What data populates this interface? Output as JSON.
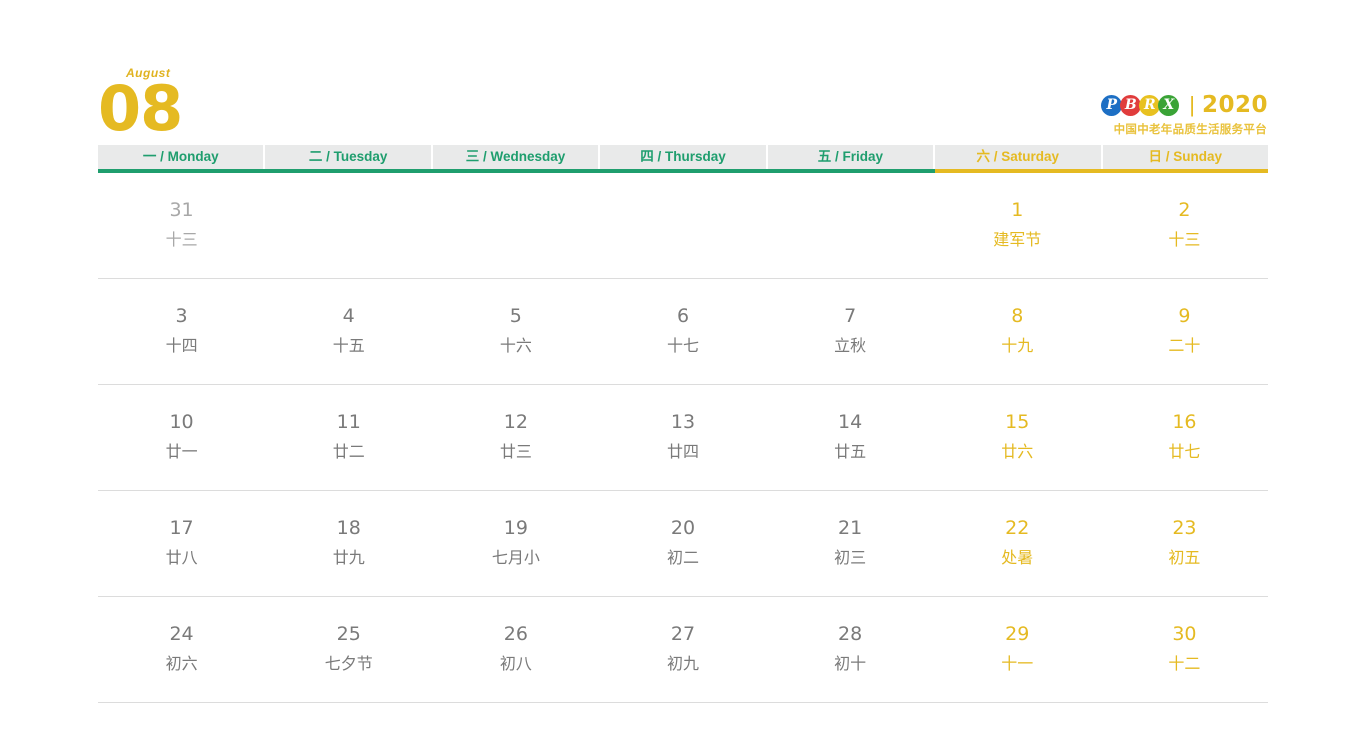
{
  "header": {
    "month_label": "August",
    "month_number": "08",
    "brand": {
      "logo_letters": [
        {
          "char": "P",
          "color": "#1d6fc4"
        },
        {
          "char": "B",
          "color": "#e03c3c"
        },
        {
          "char": "R",
          "color": "#e8c120"
        },
        {
          "char": "X",
          "color": "#3aa336"
        }
      ],
      "divider": "|",
      "year": "2020",
      "tagline": "中国中老年品质生活服务平台"
    }
  },
  "weekdays": [
    {
      "label": "一 / Monday",
      "type": "weekday"
    },
    {
      "label": "二 / Tuesday",
      "type": "weekday"
    },
    {
      "label": "三 / Wednesday",
      "type": "weekday"
    },
    {
      "label": "四 / Thursday",
      "type": "weekday"
    },
    {
      "label": "五 / Friday",
      "type": "weekday"
    },
    {
      "label": "六 / Saturday",
      "type": "weekend"
    },
    {
      "label": "日 / Sunday",
      "type": "weekend"
    }
  ],
  "colors": {
    "green": "#1f9e6e",
    "gold": "#e5ba22",
    "gray_text": "#7a7a7a",
    "muted_text": "#a8a8a8",
    "header_bg": "#e9eaea",
    "row_line": "#dcdcdc"
  },
  "weeks": [
    [
      {
        "num": "31",
        "lunar": "十三",
        "style": "muted"
      },
      {
        "num": "",
        "lunar": "",
        "style": "empty"
      },
      {
        "num": "",
        "lunar": "",
        "style": "empty"
      },
      {
        "num": "",
        "lunar": "",
        "style": "empty"
      },
      {
        "num": "",
        "lunar": "",
        "style": "empty"
      },
      {
        "num": "1",
        "lunar": "建军节",
        "style": "weekend"
      },
      {
        "num": "2",
        "lunar": "十三",
        "style": "weekend"
      }
    ],
    [
      {
        "num": "3",
        "lunar": "十四",
        "style": "normal"
      },
      {
        "num": "4",
        "lunar": "十五",
        "style": "normal"
      },
      {
        "num": "5",
        "lunar": "十六",
        "style": "normal"
      },
      {
        "num": "6",
        "lunar": "十七",
        "style": "normal"
      },
      {
        "num": "7",
        "lunar": "立秋",
        "style": "normal"
      },
      {
        "num": "8",
        "lunar": "十九",
        "style": "weekend"
      },
      {
        "num": "9",
        "lunar": "二十",
        "style": "weekend"
      }
    ],
    [
      {
        "num": "10",
        "lunar": "廿一",
        "style": "normal"
      },
      {
        "num": "11",
        "lunar": "廿二",
        "style": "normal"
      },
      {
        "num": "12",
        "lunar": "廿三",
        "style": "normal"
      },
      {
        "num": "13",
        "lunar": "廿四",
        "style": "normal"
      },
      {
        "num": "14",
        "lunar": "廿五",
        "style": "normal"
      },
      {
        "num": "15",
        "lunar": "廿六",
        "style": "weekend"
      },
      {
        "num": "16",
        "lunar": "廿七",
        "style": "weekend"
      }
    ],
    [
      {
        "num": "17",
        "lunar": "廿八",
        "style": "normal"
      },
      {
        "num": "18",
        "lunar": "廿九",
        "style": "normal"
      },
      {
        "num": "19",
        "lunar": "七月小",
        "style": "normal"
      },
      {
        "num": "20",
        "lunar": "初二",
        "style": "normal"
      },
      {
        "num": "21",
        "lunar": "初三",
        "style": "normal"
      },
      {
        "num": "22",
        "lunar": "处暑",
        "style": "weekend"
      },
      {
        "num": "23",
        "lunar": "初五",
        "style": "weekend"
      }
    ],
    [
      {
        "num": "24",
        "lunar": "初六",
        "style": "normal"
      },
      {
        "num": "25",
        "lunar": "七夕节",
        "style": "normal"
      },
      {
        "num": "26",
        "lunar": "初八",
        "style": "normal"
      },
      {
        "num": "27",
        "lunar": "初九",
        "style": "normal"
      },
      {
        "num": "28",
        "lunar": "初十",
        "style": "normal"
      },
      {
        "num": "29",
        "lunar": "十一",
        "style": "weekend"
      },
      {
        "num": "30",
        "lunar": "十二",
        "style": "weekend"
      }
    ]
  ]
}
